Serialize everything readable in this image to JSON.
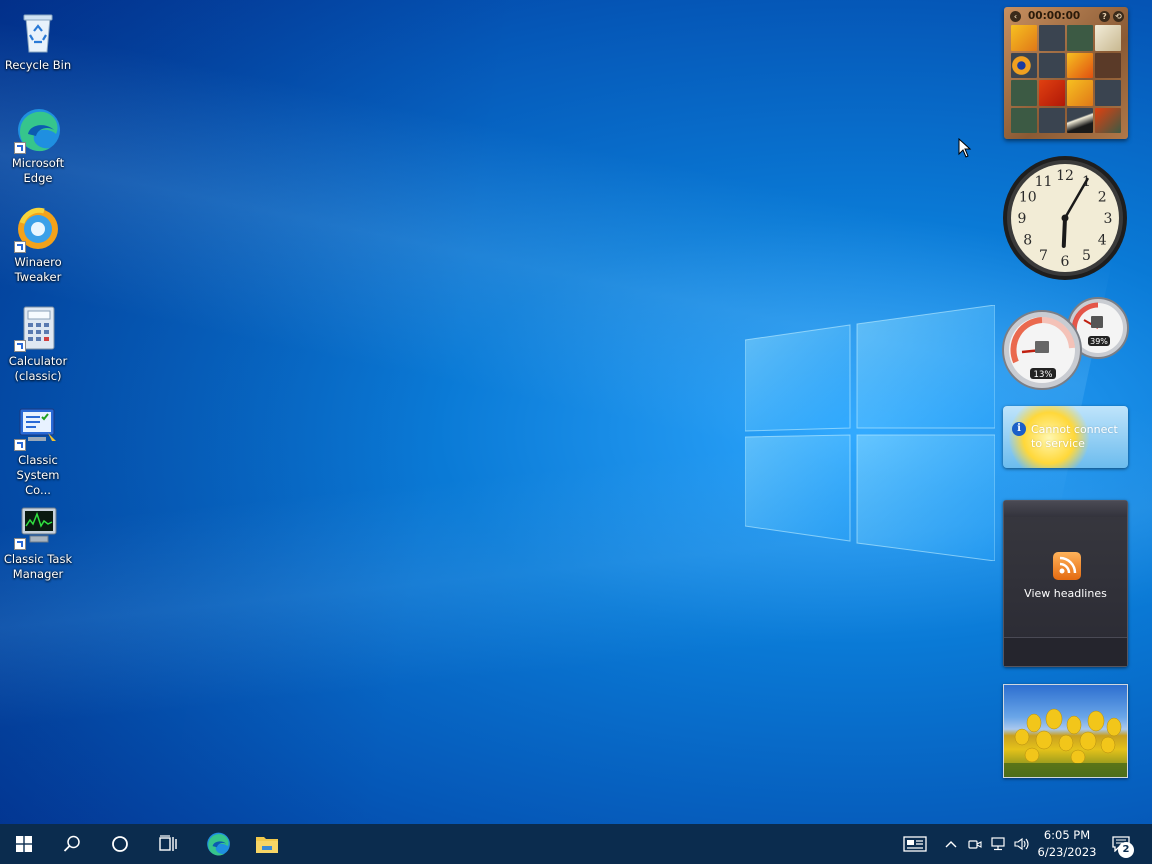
{
  "desktop": {
    "icons": [
      {
        "label": "Recycle Bin",
        "icon": "recycle-bin-icon"
      },
      {
        "label": "Microsoft\nEdge",
        "icon": "edge-icon"
      },
      {
        "label": "Winaero\nTweaker",
        "icon": "winaero-tweaker-icon"
      },
      {
        "label": "Calculator\n(classic)",
        "icon": "calculator-icon"
      },
      {
        "label": "Classic\nSystem Co...",
        "icon": "system-config-icon"
      },
      {
        "label": "Classic Task\nManager",
        "icon": "task-manager-icon"
      }
    ]
  },
  "gadgets": {
    "puzzle": {
      "timer": "00:00:00",
      "help": "?",
      "settings": "⟲"
    },
    "clock": {
      "hour": 6,
      "minute": 5,
      "numerals": [
        "12",
        "1",
        "2",
        "3",
        "4",
        "5",
        "6",
        "7",
        "8",
        "9",
        "10",
        "11"
      ]
    },
    "cpu_meter": {
      "cpu": "13%",
      "memory": "39%"
    },
    "weather": {
      "message": "Cannot connect to service"
    },
    "feed": {
      "label": "View headlines"
    }
  },
  "taskbar": {
    "time": "6:05 PM",
    "date": "6/23/2023",
    "notifications": "2",
    "buttons": [
      "start-icon",
      "search-icon",
      "cortana-icon",
      "task-view-icon",
      "edge-icon",
      "file-explorer-icon"
    ],
    "tray": [
      "news-icon",
      "chevron-up-icon",
      "meet-now-icon",
      "network-icon",
      "volume-icon"
    ]
  },
  "colors": {
    "taskbar": "#0b2c4e",
    "desktop_accent": "#0a7ad6"
  }
}
